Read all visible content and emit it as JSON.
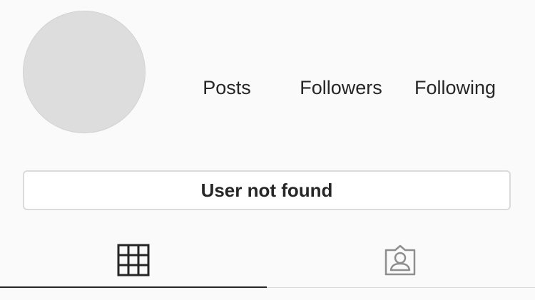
{
  "profile": {
    "stats": {
      "posts_label": "Posts",
      "followers_label": "Followers",
      "following_label": "Following"
    },
    "status_message": "User not found"
  },
  "tabs": [
    {
      "icon": "grid-icon",
      "active": true
    },
    {
      "icon": "tagged-user-icon",
      "active": false
    }
  ],
  "colors": {
    "background": "#fafafa",
    "avatar_placeholder": "#dcdddc",
    "text": "#262626",
    "border": "#dbdbdb",
    "inactive_icon": "#8e8e8e"
  }
}
